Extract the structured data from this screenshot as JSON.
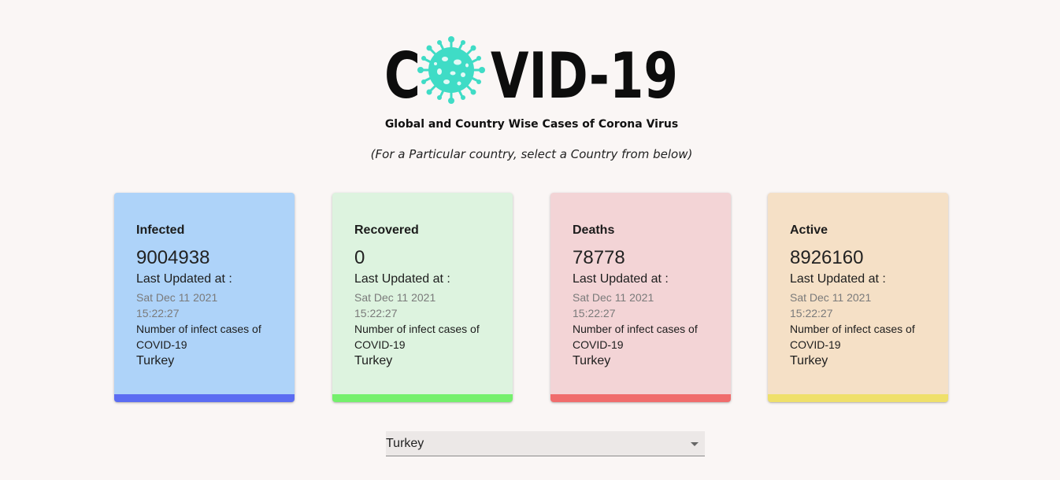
{
  "header": {
    "logo_text_left": "C",
    "logo_text_right": "VID-19",
    "subtitle": "Global and Country Wise Cases of Corona Virus",
    "instruction": "(For a Particular country, select a Country from below)"
  },
  "cards": [
    {
      "label": "Infected",
      "value": "9004938",
      "updated_label": "Last Updated at :",
      "date": "Sat Dec 11 2021 15:22:27",
      "description": "Number of infect cases of COVID-19",
      "country": "Turkey",
      "bg_color": "#aed3f9",
      "accent_color": "#5b6cf2"
    },
    {
      "label": "Recovered",
      "value": "0",
      "updated_label": "Last Updated at :",
      "date": "Sat Dec 11 2021 15:22:27",
      "description": "Number of infect cases of COVID-19",
      "country": "Turkey",
      "bg_color": "#ddf3df",
      "accent_color": "#74f06c"
    },
    {
      "label": "Deaths",
      "value": "78778",
      "updated_label": "Last Updated at :",
      "date": "Sat Dec 11 2021 15:22:27",
      "description": "Number of infect cases of COVID-19",
      "country": "Turkey",
      "bg_color": "#f3d4d6",
      "accent_color": "#f06c6c"
    },
    {
      "label": "Active",
      "value": "8926160",
      "updated_label": "Last Updated at :",
      "date": "Sat Dec 11 2021 15:22:27",
      "description": "Number of infect cases of COVID-19",
      "country": "Turkey",
      "bg_color": "#f5e0c6",
      "accent_color": "#efe06a"
    }
  ],
  "country_select": {
    "selected": "Turkey",
    "icon": "chevron-down-icon"
  },
  "colors": {
    "page_bg": "#faf6f5",
    "virus_teal": "#3fdcc6"
  }
}
